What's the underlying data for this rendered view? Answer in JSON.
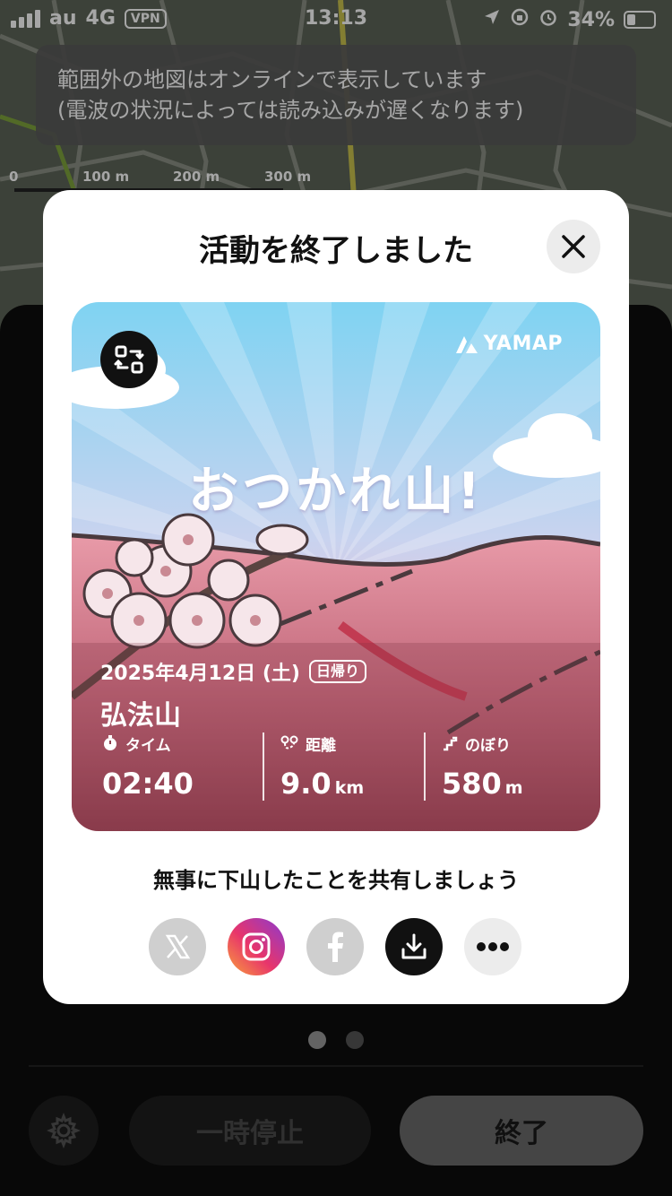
{
  "status_bar": {
    "carrier": "au",
    "network": "4G",
    "vpn": "VPN",
    "time": "13:13",
    "battery": "34%",
    "icons": [
      "signal-icon",
      "location-arrow-icon",
      "rotation-lock-icon",
      "alarm-icon",
      "battery-icon"
    ]
  },
  "map": {
    "toast_line1": "範囲外の地図はオンラインで表示しています",
    "toast_line2": "(電波の状況によっては読み込みが遅くなります)",
    "scale": [
      "0",
      "100 m",
      "200 m",
      "300 m"
    ]
  },
  "background_panel": {
    "pause_label": "一時停止",
    "end_label": "終了",
    "page_dots": 2,
    "active_dot": 0
  },
  "modal": {
    "title": "活動を終了しました",
    "card": {
      "brand": "YAMAP",
      "headline": "おつかれ山!",
      "date": "2025年4月12日 (土)",
      "trip_type": "日帰り",
      "mountain": "弘法山",
      "stats": {
        "time": {
          "label": "タイム",
          "value": "02:40",
          "unit": ""
        },
        "distance": {
          "label": "距離",
          "value": "9.0",
          "unit": "km"
        },
        "ascent": {
          "label": "のぼり",
          "value": "580",
          "unit": "m"
        }
      }
    },
    "share_text": "無事に下山したことを共有しましょう",
    "share_targets": [
      "x-icon",
      "instagram-icon",
      "facebook-icon",
      "download-icon",
      "more-icon"
    ]
  },
  "colors": {
    "card_sky_top": "#7fd3f2",
    "card_sky_mid": "#c9d3ef",
    "card_pink": "#e89aa8",
    "card_bottom": "#8e3f4f",
    "ig_gradient": [
      "#f9a13a",
      "#e8356b",
      "#8b3ad0"
    ]
  }
}
